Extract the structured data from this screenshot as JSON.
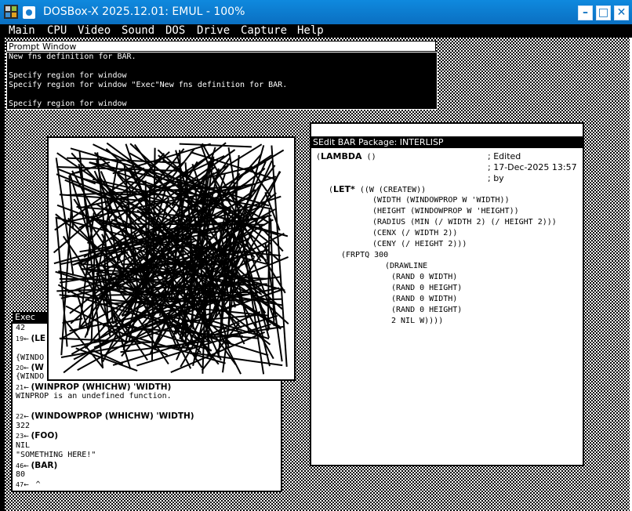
{
  "window": {
    "title": "DOSBox-X 2025.12.01: EMUL - 100%",
    "minimize": "–",
    "maximize": "□",
    "close": "✕"
  },
  "menubar": [
    "Main",
    "CPU",
    "Video",
    "Sound",
    "DOS",
    "Drive",
    "Capture",
    "Help"
  ],
  "prompt_window": {
    "title": "Prompt Window",
    "lines": [
      "New fns definition for BAR.",
      "",
      "Specify region for window",
      "Specify region for window \"Exec\"New fns definition for BAR.",
      "",
      "Specify region for window"
    ]
  },
  "exec_window": {
    "title": "Exec",
    "lines": [
      {
        "n": "",
        "cmd": "",
        "out": "42"
      },
      {
        "n": "19←",
        "cmd": "(LE",
        "out": ""
      },
      {
        "n": "",
        "cmd": "",
        "out": "{WINDO"
      },
      {
        "n": "20←",
        "cmd": "(W",
        "out": ""
      },
      {
        "n": "",
        "cmd": "",
        "out": "{WINDO"
      },
      {
        "n": "21←",
        "cmd": "(WINPROP (WHICHW) 'WIDTH)",
        "out": ""
      },
      {
        "n": "",
        "cmd": "",
        "out": "WINPROP is an undefined function."
      },
      {
        "n": "",
        "cmd": "",
        "out": ""
      },
      {
        "n": "22←",
        "cmd": "(WINDOWPROP (WHICHW) 'WIDTH)",
        "out": ""
      },
      {
        "n": "",
        "cmd": "",
        "out": "322"
      },
      {
        "n": "23←",
        "cmd": "(FOO)",
        "out": ""
      },
      {
        "n": "",
        "cmd": "",
        "out": "NIL"
      },
      {
        "n": "",
        "cmd": "",
        "out": "\"SOMETHING HERE!\""
      },
      {
        "n": "46←",
        "cmd": "(BAR)",
        "out": ""
      },
      {
        "n": "",
        "cmd": "",
        "out": "80"
      },
      {
        "n": "47←",
        "cmd": "",
        "out": "",
        "caret": "^"
      }
    ]
  },
  "sedit_window": {
    "title": "SEdit BAR Package: INTERLISP",
    "lines": [
      {
        "indent": 0,
        "parts": [
          {
            "t": "(",
            "s": "m"
          },
          {
            "t": "LAMBDA",
            "s": "b"
          },
          {
            "t": " ()",
            "s": "m"
          }
        ]
      },
      {
        "indent": 0,
        "parts": []
      },
      {
        "indent": 0,
        "parts": []
      },
      {
        "indent": 2,
        "parts": [
          {
            "t": "(",
            "s": "m"
          },
          {
            "t": "LET*",
            "s": "b"
          },
          {
            "t": " ((W (CREATEW))",
            "s": "m"
          }
        ]
      },
      {
        "indent": 9,
        "parts": [
          {
            "t": "(WIDTH (WINDOWPROP W 'WIDTH))",
            "s": "m"
          }
        ]
      },
      {
        "indent": 9,
        "parts": [
          {
            "t": "(HEIGHT (WINDOWPROP W 'HEIGHT))",
            "s": "m"
          }
        ]
      },
      {
        "indent": 9,
        "parts": [
          {
            "t": "(RADIUS (MIN (/ WIDTH 2) (/ HEIGHT 2)))",
            "s": "m"
          }
        ]
      },
      {
        "indent": 9,
        "parts": [
          {
            "t": "(CENX (/ WIDTH 2))",
            "s": "m"
          }
        ]
      },
      {
        "indent": 9,
        "parts": [
          {
            "t": "(CENY (/ HEIGHT 2)))",
            "s": "m"
          }
        ]
      },
      {
        "indent": 4,
        "parts": [
          {
            "t": "(FRPTQ 300",
            "s": "m"
          }
        ]
      },
      {
        "indent": 11,
        "parts": [
          {
            "t": "(DRAWLINE",
            "s": "m"
          }
        ]
      },
      {
        "indent": 12,
        "parts": [
          {
            "t": "(RAND 0 WIDTH)",
            "s": "m"
          }
        ]
      },
      {
        "indent": 12,
        "parts": [
          {
            "t": "(RAND 0 HEIGHT)",
            "s": "m"
          }
        ]
      },
      {
        "indent": 12,
        "parts": [
          {
            "t": "(RAND 0 WIDTH)",
            "s": "m"
          }
        ]
      },
      {
        "indent": 12,
        "parts": [
          {
            "t": "(RAND 0 HEIGHT)",
            "s": "m"
          }
        ]
      },
      {
        "indent": 12,
        "parts": [
          {
            "t": "2 NIL W))))",
            "s": "m"
          }
        ]
      }
    ],
    "comments": [
      "; Edited",
      "; 17-Dec-2025 13:57",
      "; by"
    ]
  },
  "drawing_window": {
    "line_count": 300
  }
}
